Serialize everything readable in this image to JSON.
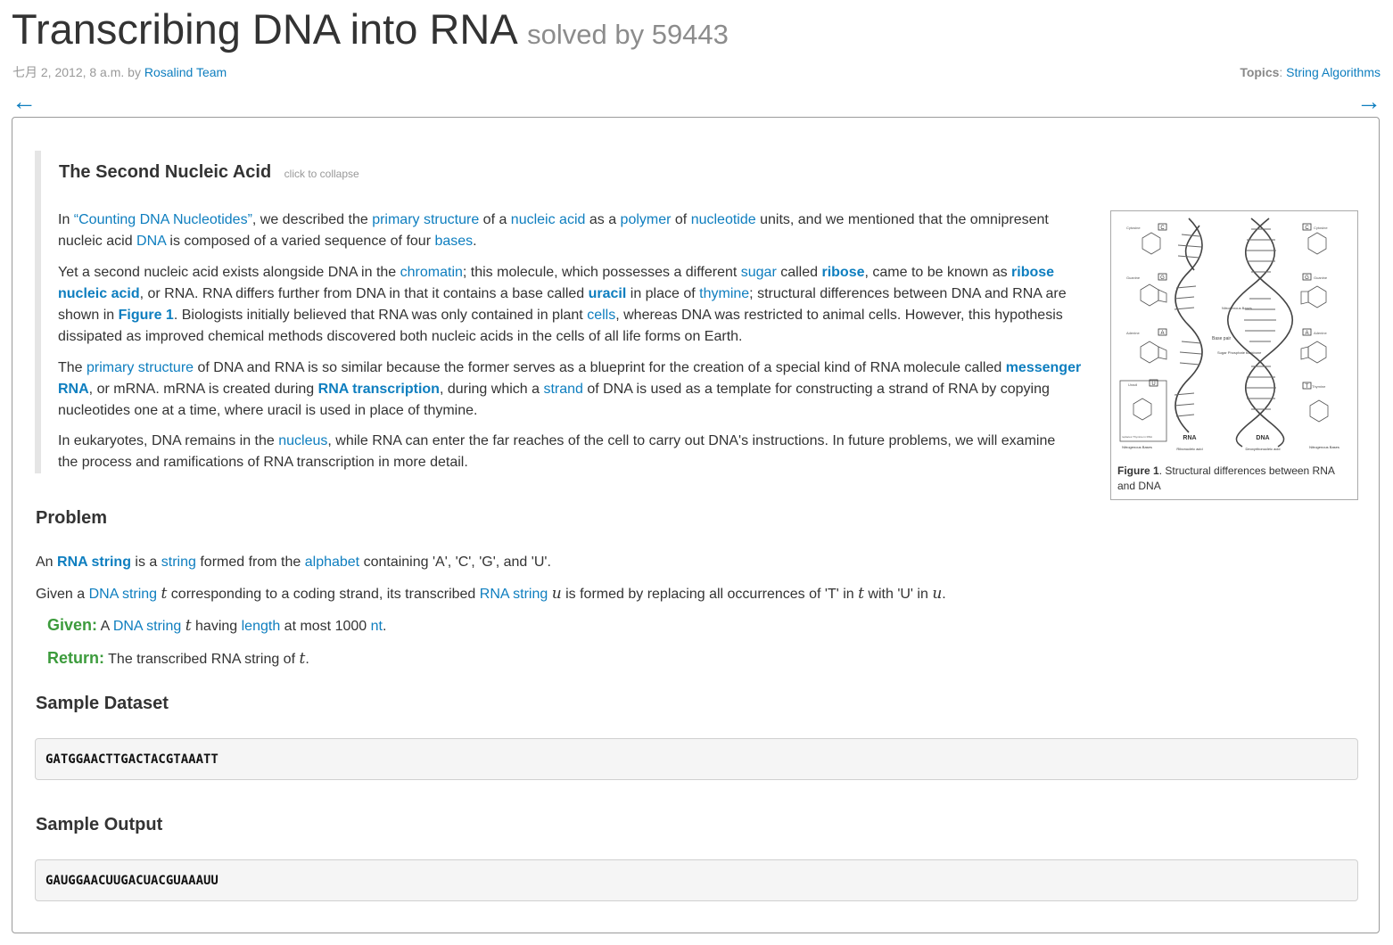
{
  "title": "Transcribing DNA into RNA",
  "solved_by": "solved by 59443",
  "meta": {
    "date": "七月 2, 2012, 8 a.m. by",
    "author": "Rosalind Team"
  },
  "topics": {
    "label": "Topics",
    "value": "String Algorithms"
  },
  "nav": {
    "prev": "←",
    "next": "→"
  },
  "collapsible": {
    "title": "The Second Nucleic Acid",
    "hint": "click to collapse"
  },
  "p1": {
    "t1": "In ",
    "link1": "“Counting DNA Nucleotides”",
    "t2": ", we described the ",
    "link2": "primary structure",
    "t3": " of a ",
    "link3": "nucleic acid",
    "t4": " as a ",
    "link4": "polymer",
    "t5": " of ",
    "link5": "nucleotide",
    "t6": " units, and we mentioned that the omnipresent nucleic acid ",
    "link6": "DNA",
    "t7": " is composed of a varied sequence of four ",
    "link7": "bases",
    "t8": "."
  },
  "p2": {
    "t1": "Yet a second nucleic acid exists alongside DNA in the ",
    "link1": "chromatin",
    "t2": "; this molecule, which possesses a different ",
    "link2": "sugar",
    "t3": " called ",
    "link3": "ribose",
    "t4": ", came to be known as ",
    "link4": "ribose nucleic acid",
    "t5": ", or RNA. RNA differs further from DNA in that it contains a base called ",
    "link5": "uracil",
    "t6": " in place of ",
    "link6": "thymine",
    "t7": "; structural differences between DNA and RNA are shown in ",
    "link7": "Figure 1",
    "t8": ". Biologists initially believed that RNA was only contained in plant ",
    "link8": "cells",
    "t9": ", whereas DNA was restricted to animal cells. However, this hypothesis dissipated as improved chemical methods discovered both nucleic acids in the cells of all life forms on Earth."
  },
  "p3": {
    "t1": "The ",
    "link1": "primary structure",
    "t2": " of DNA and RNA is so similar because the former serves as a blueprint for the creation of a special kind of RNA molecule called ",
    "link2": "messenger RNA",
    "t3": ", or mRNA. mRNA is created during ",
    "link3": "RNA transcription",
    "t4": ", during which a ",
    "link4": "strand",
    "t5": " of DNA is used as a template for constructing a strand of RNA by copying nucleotides one at a time, where uracil is used in place of thymine."
  },
  "p4": {
    "t1": "In eukaryotes, DNA remains in the ",
    "link1": "nucleus",
    "t2": ", while RNA can enter the far reaches of the cell to carry out DNA's instructions. In future problems, we will examine the process and ramifications of RNA transcription in more detail."
  },
  "figure": {
    "label": "Figure 1",
    "caption": ". Structural differences between RNA and DNA",
    "inner_labels": {
      "rna": "RNA",
      "rna_sub": "Ribonucleic acid",
      "dna": "DNA",
      "dna_sub": "Deoxyribonucleic acid",
      "base_pair": "Base pair",
      "nitro_bases": "Nitrogenous Bases",
      "backbone": "Sugar Phosphate backbone",
      "nitro_left": "Nitrogenous Bases",
      "nitro_right": "Nitrogenous Bases",
      "cytosine_left": "Cytosine",
      "cytosine_right": "Cytosine",
      "guanine_left": "Guanine",
      "guanine_right": "Guanine",
      "adenine_left": "Adenine",
      "adenine_right": "Adenine",
      "uracil": "Uracil",
      "thymine": "Thymine",
      "replaces": "replaces Thymine in RNA",
      "c": "C",
      "g": "G",
      "a": "A",
      "u": "U",
      "t": "T"
    }
  },
  "problem": {
    "heading": "Problem",
    "line1": {
      "t1": "An ",
      "link1": "RNA string",
      "t2": " is a ",
      "link2": "string",
      "t3": " formed from the ",
      "link3": "alphabet",
      "t4": " containing 'A', 'C', 'G', and 'U'."
    },
    "line2": {
      "t1": "Given a ",
      "link1": "DNA string",
      "v1": "t",
      "t2": " corresponding to a coding strand, its transcribed ",
      "link2": "RNA string",
      "v2": "u",
      "t3": " is formed by replacing all occurrences of 'T' in ",
      "v3": "t",
      "t4": " with 'U' in ",
      "v4": "u",
      "t5": "."
    },
    "given": {
      "label": "Given:",
      "t1": " A ",
      "link1": "DNA string",
      "v1": "t",
      "t2": " having ",
      "link2": "length",
      "t3": " at most 1000 ",
      "link3": "nt",
      "t4": "."
    },
    "return": {
      "label": "Return:",
      "t1": " The transcribed RNA string of ",
      "v1": "t",
      "t2": "."
    }
  },
  "sample_dataset": {
    "heading": "Sample Dataset",
    "value": "GATGGAACTTGACTACGTAAATT"
  },
  "sample_output": {
    "heading": "Sample Output",
    "value": "GAUGGAACUUGACUACGUAAAUU"
  }
}
